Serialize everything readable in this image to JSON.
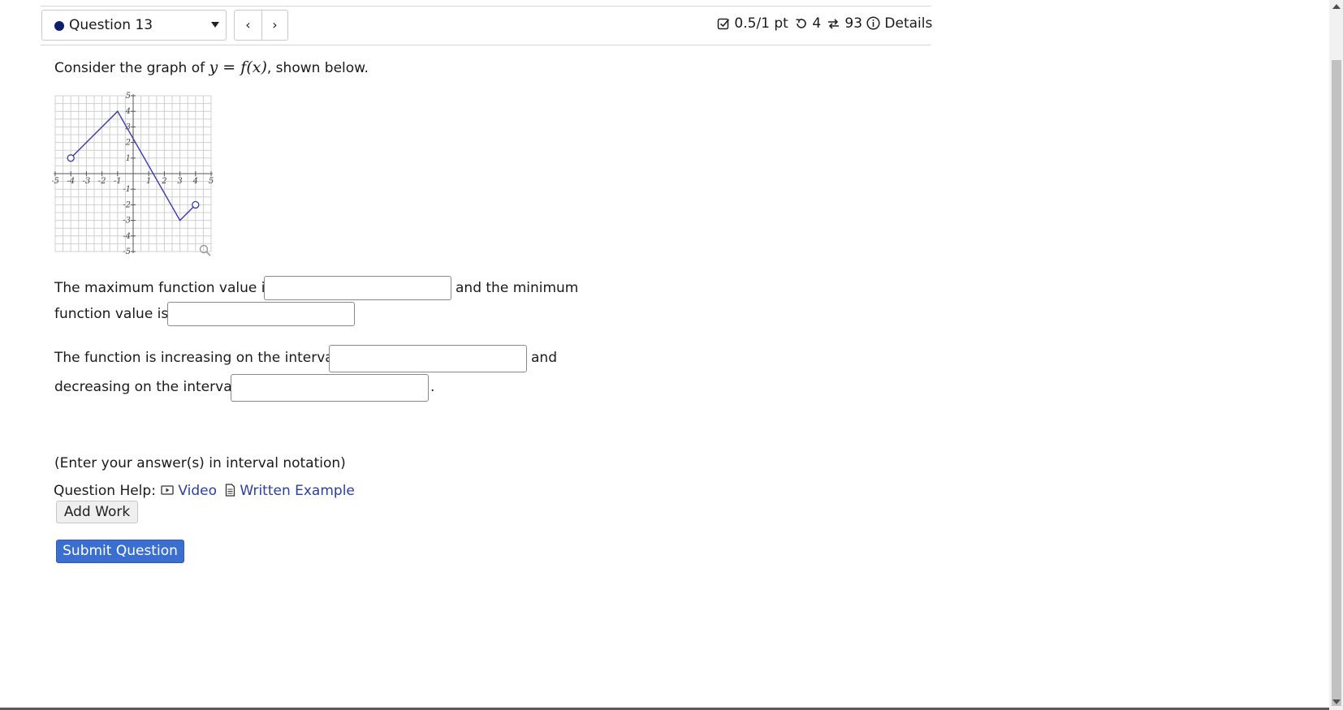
{
  "header": {
    "question_label": "Question 13",
    "nav_prev": "‹",
    "nav_next": "›",
    "score": "0.5/1 pt",
    "retries": "4",
    "attempts": "93",
    "details": "Details"
  },
  "question": {
    "intro_before": "Consider the graph of ",
    "intro_math_y": "y",
    "intro_math_eq": " = ",
    "intro_math_f": "f",
    "intro_math_paren_open": "(",
    "intro_math_x": "x",
    "intro_math_paren_close": ")",
    "intro_after": ", shown below.",
    "max_label": "The maximum function value is",
    "and_min_label": "and the minimum",
    "min_label": "function value is",
    "inc_label": "The function is increasing on the interval",
    "and_label": "and",
    "dec_label": "decreasing on the interval",
    "period": ".",
    "hint": "(Enter your answer(s) in interval notation)"
  },
  "inputs": {
    "max_value": "",
    "min_value": "",
    "increasing_interval": "",
    "decreasing_interval": ""
  },
  "help": {
    "label": "Question Help:",
    "video": "Video",
    "written_example": "Written Example"
  },
  "buttons": {
    "add_work": "Add Work",
    "submit": "Submit Question"
  },
  "chart_data": {
    "type": "line",
    "xlim": [
      -5,
      5
    ],
    "ylim": [
      -5,
      5
    ],
    "grid": true,
    "x_ticks": [
      "-5",
      "-4",
      "-3",
      "-2",
      "-1",
      "1",
      "2",
      "3",
      "4",
      "5"
    ],
    "y_ticks": [
      "5",
      "4",
      "3",
      "2",
      "1",
      "-1",
      "-2",
      "-3",
      "-4",
      "-5"
    ],
    "series": [
      {
        "points": [
          [
            -4,
            1
          ],
          [
            -1,
            4
          ],
          [
            3,
            -3
          ],
          [
            4,
            -2
          ]
        ],
        "open_endpoints": [
          [
            -4,
            1
          ],
          [
            4,
            -2
          ]
        ],
        "color": "#3a3ab0"
      }
    ]
  }
}
